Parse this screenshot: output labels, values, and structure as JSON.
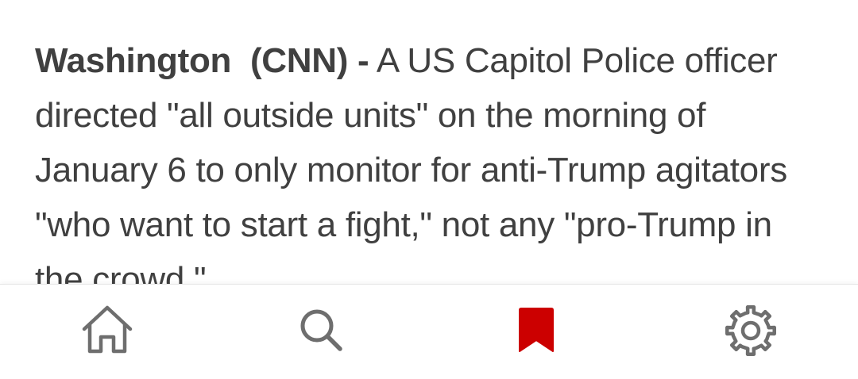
{
  "article": {
    "dateline": "Washington  (CNN) -",
    "body": "A US Capitol Police officer directed \"all outside units\" on the morning of January 6 to only monitor for anti-Trump agitators \"who want to start a fight,\" not any \"pro-Trump in the crowd.\""
  },
  "bottom_nav": {
    "items": [
      {
        "name": "home",
        "icon": "home-icon",
        "active": false
      },
      {
        "name": "search",
        "icon": "search-icon",
        "active": false
      },
      {
        "name": "saved",
        "icon": "bookmark-icon",
        "active": true
      },
      {
        "name": "settings",
        "icon": "gear-icon",
        "active": false
      }
    ]
  },
  "colors": {
    "text": "#404040",
    "icon_inactive": "#6e6e6e",
    "accent": "#cc0000"
  }
}
